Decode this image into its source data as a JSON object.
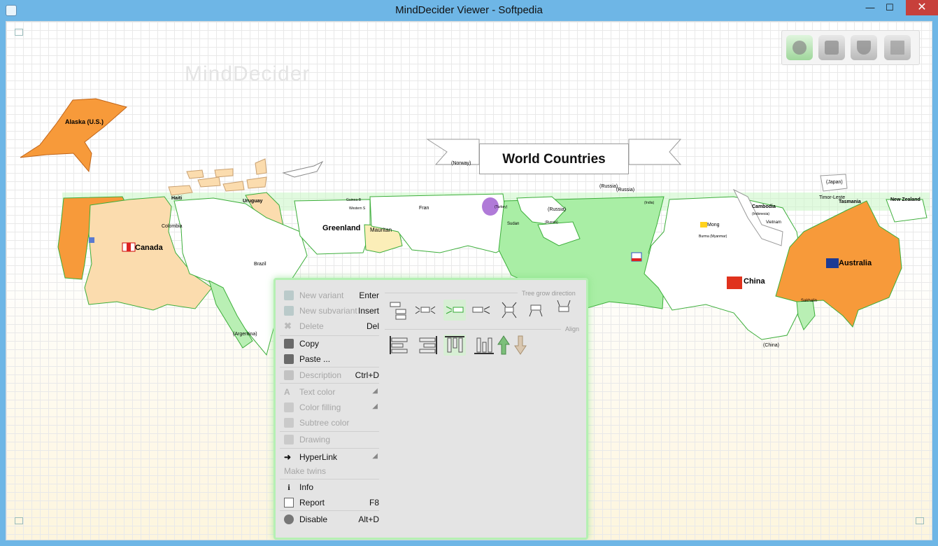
{
  "window": {
    "title": "MindDecider Viewer - Softpedia"
  },
  "watermark": "MindDecider",
  "root_topic": "World Countries",
  "map_labels": {
    "alaska": "Alaska (U.S.)",
    "canada": "Canada",
    "colombia": "Colombia",
    "brazil": "Brazil",
    "argentina": "(Argentina)",
    "uruguay": "Uruguay",
    "haiti": "Haiti",
    "greenland": "Greenland",
    "mauritania": "Mauritan",
    "norway": "(Norway)",
    "turkey": "(Turkey)",
    "russia1": "(Russia)",
    "russia2": "(Russia)",
    "russia3": "(Russia)",
    "russia4": "(Russia)",
    "china": "China",
    "china2": "(China)",
    "japan": "(Japan)",
    "australia": "Australia",
    "new_zealand": "New Zealand",
    "indonesia": "(Indonesia)",
    "burma": "Burma (Myanmar)",
    "mongolia": "Mong",
    "sakhalin": "Sakhalin",
    "tasmania": "Tasmania",
    "timor": "Timor-Leste",
    "vietnam": "Vietnam",
    "cambodia": "Cambodia",
    "india": "(India)",
    "sudan": "Sudan",
    "france": "Fran",
    "guinea": "Guinea-B",
    "western": "Western S"
  },
  "toolbar": {
    "tools": [
      {
        "name": "mindmap-view",
        "active": true
      },
      {
        "name": "decision-view",
        "active": false
      },
      {
        "name": "filter-view",
        "active": false
      },
      {
        "name": "text-view",
        "active": false
      }
    ]
  },
  "context_menu": {
    "items": [
      {
        "label": "New variant",
        "shortcut": "Enter",
        "disabled": true
      },
      {
        "label": "New subvariant",
        "shortcut": "Insert",
        "disabled": true
      },
      {
        "label": "Delete",
        "shortcut": "Del",
        "disabled": true
      },
      {
        "label": "Copy",
        "shortcut": "",
        "disabled": false
      },
      {
        "label": "Paste ...",
        "shortcut": "",
        "disabled": false
      },
      {
        "label": "Description",
        "shortcut": "Ctrl+D",
        "disabled": true
      },
      {
        "label": "Text color",
        "shortcut": "",
        "disabled": true
      },
      {
        "label": "Color filling",
        "shortcut": "",
        "disabled": true
      },
      {
        "label": "Subtree color",
        "shortcut": "",
        "disabled": true
      },
      {
        "label": "Drawing",
        "shortcut": "",
        "disabled": true
      },
      {
        "label": "HyperLink",
        "shortcut": "",
        "disabled": false
      },
      {
        "label": "Make twins",
        "shortcut": "",
        "disabled": true
      },
      {
        "label": "Info",
        "shortcut": "",
        "disabled": false
      },
      {
        "label": "Report",
        "shortcut": "F8",
        "disabled": false
      },
      {
        "label": "Disable",
        "shortcut": "Alt+D",
        "disabled": false
      }
    ],
    "panel": {
      "tree_grow_label": "Tree grow direction",
      "align_label": "Align"
    }
  },
  "colors": {
    "orange": "#f79a3a",
    "light_orange": "#fbdcae",
    "green": "#a9eea5",
    "purple": "#b07ad8"
  }
}
